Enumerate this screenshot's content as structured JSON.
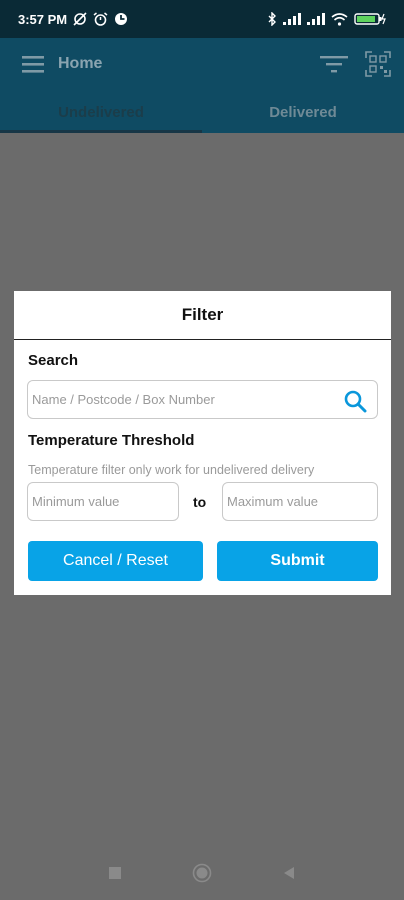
{
  "status_bar": {
    "time": "3:57 PM",
    "icons_left": [
      "sync-off-icon",
      "alarm-icon",
      "data-saver-icon"
    ],
    "icons_right": [
      "bluetooth-icon",
      "signal-icon",
      "signal-icon",
      "wifi-icon",
      "battery-charging-icon"
    ]
  },
  "toolbar": {
    "title": "Home",
    "menu_icon": "hamburger-menu-icon",
    "filter_icon": "filter-icon",
    "qr_icon": "qr-scan-icon"
  },
  "tabs": [
    {
      "label": "Undelivered",
      "active": true
    },
    {
      "label": "Delivered",
      "active": false
    }
  ],
  "dialog": {
    "title": "Filter",
    "search": {
      "label": "Search",
      "placeholder": "Name / Postcode / Box Number",
      "value": ""
    },
    "temperature": {
      "label": "Temperature Threshold",
      "helper": "Temperature filter only work for undelivered delivery",
      "min_placeholder": "Minimum value",
      "max_placeholder": "Maximum value",
      "separator": "to"
    },
    "buttons": {
      "cancel": "Cancel / Reset",
      "submit": "Submit"
    }
  },
  "colors": {
    "appbar": "#0f4b63",
    "statusbar": "#0a2a36",
    "accent": "#08a3e7",
    "overlay": "#6b6b6b"
  },
  "nav_bar": [
    "recents-icon",
    "home-icon",
    "back-icon"
  ]
}
